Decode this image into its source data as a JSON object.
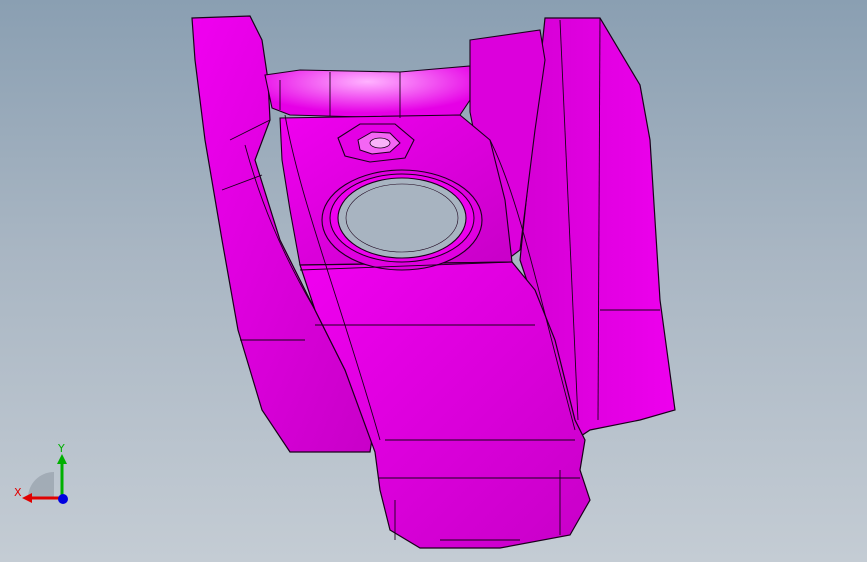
{
  "viewport": {
    "background_top": "#8a9fb2",
    "background_bottom": "#c4ccd4"
  },
  "model": {
    "fill_color": "#e600e6",
    "edge_color": "#1a001a"
  },
  "triad": {
    "x_label": "X",
    "y_label": "Y",
    "x_color": "#e00000",
    "y_color": "#00b000",
    "z_color": "#0000e0"
  }
}
